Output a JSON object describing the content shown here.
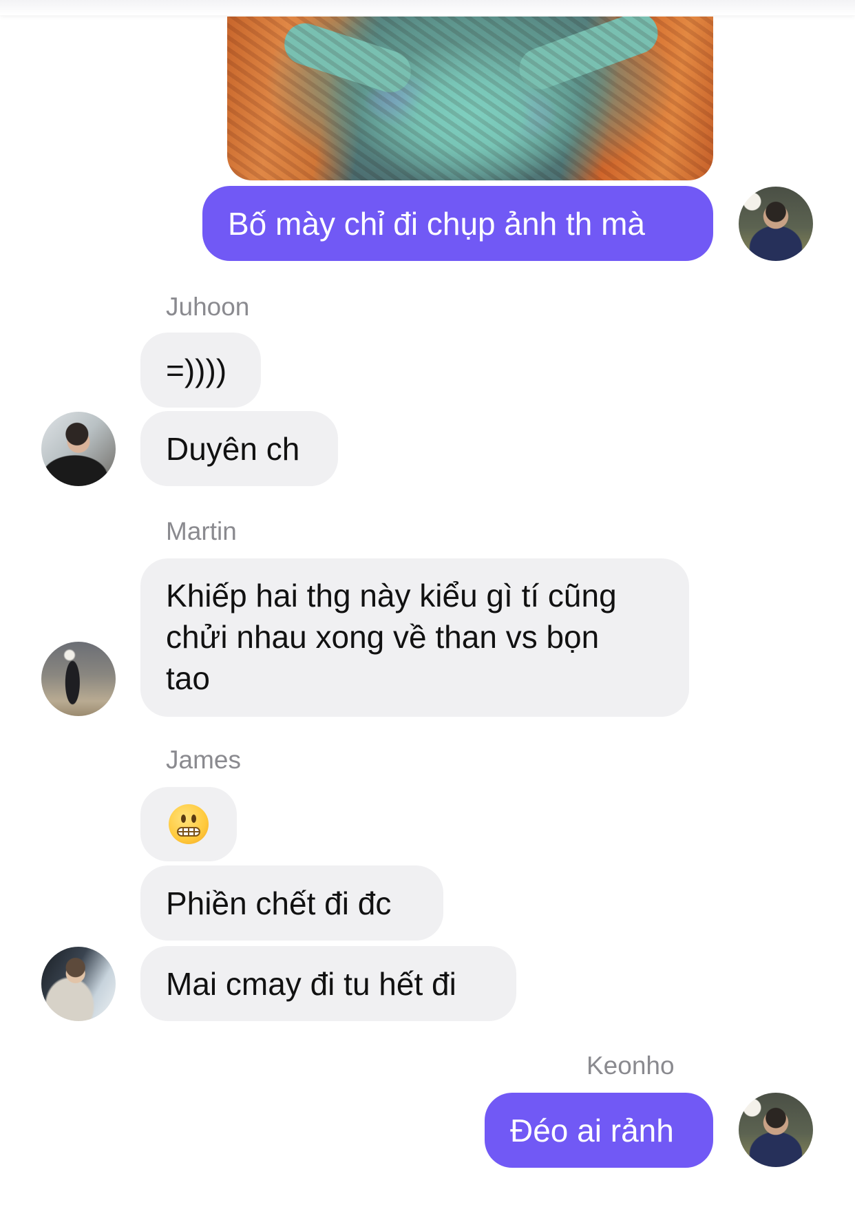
{
  "colors": {
    "outgoing_bubble": "#7159f5",
    "incoming_bubble": "#f0f0f2",
    "sender_name": "#8a8a8f"
  },
  "messages": {
    "m1": {
      "text": "Bố mày chỉ đi chụp ảnh th mà"
    },
    "juhoon": {
      "sender": "Juhoon",
      "m1": "=))))",
      "m2": "Duyên ch"
    },
    "martin": {
      "sender": "Martin",
      "line1": "Khiếp hai thg này kiểu gì tí cũng",
      "line2": "chửi nhau xong về than vs bọn",
      "line3": "tao"
    },
    "james": {
      "sender": "James",
      "m1_icon": "grimacing-face-emoji",
      "m2": "Phiền chết đi đc",
      "m3": "Mai cmay đi tu hết đi"
    },
    "keonho": {
      "sender": "Keonho",
      "m1": "Đéo ai rảnh"
    }
  }
}
